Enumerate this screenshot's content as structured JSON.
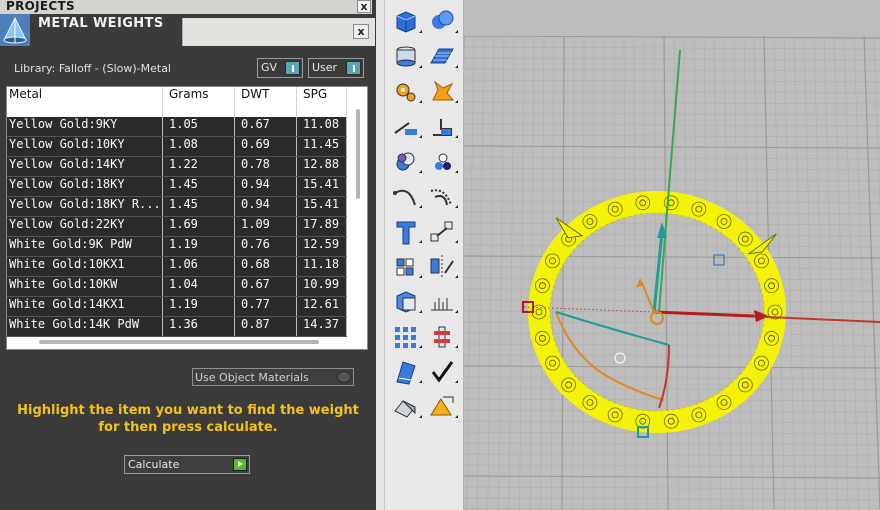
{
  "projects_bar": {
    "title": "PROJECTS",
    "close": "x"
  },
  "metal_weights": {
    "title": "METAL WEIGHTS",
    "close": "x"
  },
  "library": {
    "label": "Library: Falloff - (Slow)-Metal"
  },
  "toggles": {
    "gv": "GV",
    "user": "User"
  },
  "table": {
    "headers": [
      "Metal",
      "Grams",
      "DWT",
      "SPG"
    ],
    "rows": [
      [
        "Yellow Gold:9KY",
        "1.05",
        "0.67",
        "11.08"
      ],
      [
        "Yellow Gold:10KY",
        "1.08",
        "0.69",
        "11.45"
      ],
      [
        "Yellow Gold:14KY",
        "1.22",
        "0.78",
        "12.88"
      ],
      [
        "Yellow Gold:18KY",
        "1.45",
        "0.94",
        "15.41"
      ],
      [
        "Yellow Gold:18KY R...",
        "1.45",
        "0.94",
        "15.41"
      ],
      [
        "Yellow Gold:22KY",
        "1.69",
        "1.09",
        "17.89"
      ],
      [
        "White Gold:9K PdW",
        "1.19",
        "0.76",
        "12.59"
      ],
      [
        "White Gold:10KX1",
        "1.06",
        "0.68",
        "11.18"
      ],
      [
        "White Gold:10KW",
        "1.04",
        "0.67",
        "10.99"
      ],
      [
        "White Gold:14KX1",
        "1.19",
        "0.77",
        "12.61"
      ],
      [
        "White Gold:14K PdW",
        "1.36",
        "0.87",
        "14.37"
      ]
    ]
  },
  "use_object_materials": "Use Object Materials",
  "instruction": "Highlight the item you want to find the weight for then press calculate.",
  "calculate": "Calculate",
  "colors": {
    "highlight_text": "#f3c21a",
    "panel_bg": "#3b3b3b",
    "row_bg": "#2b2b2b",
    "selection_yellow": "#f5f20a",
    "axis_green": "#3aa64a",
    "axis_red": "#c0392b"
  },
  "toolbar_icons": [
    [
      "box-icon",
      "sphere-icon"
    ],
    [
      "cylinder-icon",
      "plane-surface-icon"
    ],
    [
      "gear-icon",
      "explode-icon"
    ],
    [
      "extrude-curve-icon",
      "extrude-surface-icon"
    ],
    [
      "boolean-icon",
      "spheres-group-icon"
    ],
    [
      "arc-curve-icon",
      "curve-offset-icon"
    ],
    [
      "text-icon",
      "scale-icon"
    ],
    [
      "array-icon",
      "mirror-icon"
    ],
    [
      "solid-edit-icon",
      "gumball-icon"
    ],
    [
      "grid-array-icon",
      "align-icon"
    ],
    [
      "bend-icon",
      "check-icon"
    ],
    [
      "pyramid-icon",
      "stone-setting-icon"
    ]
  ]
}
